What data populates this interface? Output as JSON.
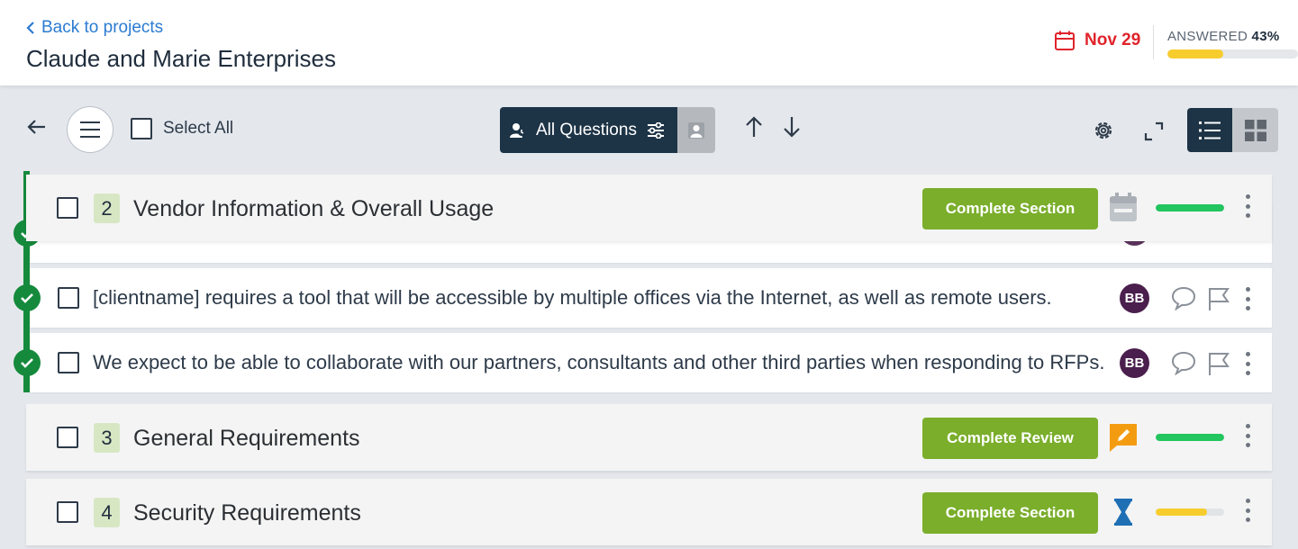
{
  "header": {
    "back_label": "Back to projects",
    "project_title": "Claude and Marie Enterprises",
    "due_date": "Nov 29",
    "answered_label": "ANSWERED",
    "answered_percent": "43%",
    "answered_fraction": 0.43
  },
  "toolbar": {
    "select_all_label": "Select All",
    "filter_label": "All Questions"
  },
  "sections": [
    {
      "number": "2",
      "title": "Vendor Information & Overall Usage",
      "button_label": "Complete Section",
      "status_icon": "calendar-icon",
      "progress": 1.0,
      "progress_color": "#22c55e"
    },
    {
      "number": "3",
      "title": "General Requirements",
      "button_label": "Complete Review",
      "status_icon": "edit-icon",
      "progress": 1.0,
      "progress_color": "#22c55e"
    },
    {
      "number": "4",
      "title": "Security Requirements",
      "button_label": "Complete Section",
      "status_icon": "hourglass-icon",
      "progress": 0.75,
      "progress_color": "#f7cd2e"
    }
  ],
  "questions": [
    {
      "text": "[clientname] requires a tool that will be accessible by multiple offices via the Internet, as well as remote users.",
      "avatar": "BB"
    },
    {
      "text": "We expect to be able to collaborate with our partners, consultants and other third parties when responding to RFPs.",
      "avatar": "BB"
    }
  ],
  "colors": {
    "accent_navy": "#1d3346",
    "button_green": "#7aae2b",
    "timeline_green": "#158a3c",
    "due_red": "#e0242b",
    "link_blue": "#2b7bd1"
  }
}
